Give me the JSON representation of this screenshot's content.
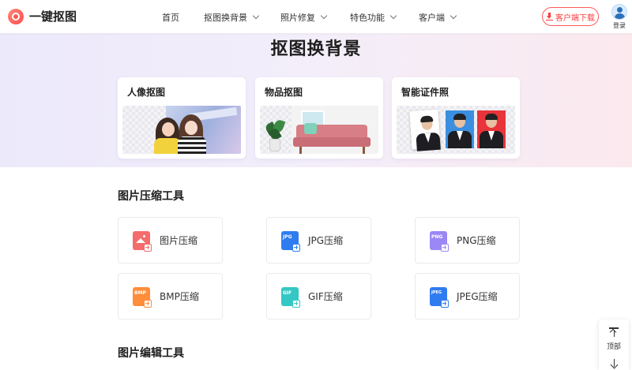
{
  "brand": {
    "name": "一键抠图",
    "logo_icon": "logo-icon"
  },
  "nav": [
    {
      "label": "首页",
      "has_dropdown": false
    },
    {
      "label": "抠图换背景",
      "has_dropdown": true
    },
    {
      "label": "照片修复",
      "has_dropdown": true
    },
    {
      "label": "特色功能",
      "has_dropdown": true
    },
    {
      "label": "客户端",
      "has_dropdown": true
    }
  ],
  "header": {
    "download_label": "客户端下载",
    "login_label": "登录"
  },
  "hero": {
    "title": "抠图换背景",
    "cards": [
      {
        "title": "人像抠图"
      },
      {
        "title": "物品抠图"
      },
      {
        "title": "智能证件照"
      }
    ]
  },
  "compress": {
    "title": "图片压缩工具",
    "tools": [
      {
        "label": "图片压缩",
        "tag": "",
        "color": "#f46c6c"
      },
      {
        "label": "JPG压缩",
        "tag": "JPG",
        "color": "#2f7cf0"
      },
      {
        "label": "PNG压缩",
        "tag": "PNG",
        "color": "#9b87f5"
      },
      {
        "label": "BMP压缩",
        "tag": "BMP",
        "color": "#ff8d3a"
      },
      {
        "label": "GIF压缩",
        "tag": "GIF",
        "color": "#35c7c4"
      },
      {
        "label": "JPEG压缩",
        "tag": "JPEG",
        "color": "#2f7cf0"
      }
    ]
  },
  "edit": {
    "title": "图片编辑工具"
  },
  "side": {
    "top_label": "顶部"
  }
}
